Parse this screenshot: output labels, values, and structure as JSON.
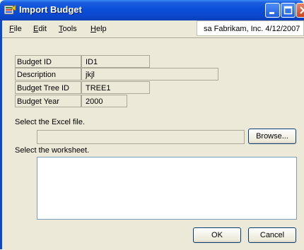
{
  "window": {
    "title": "Import Budget",
    "controls": {
      "minimize": "minimize",
      "maximize": "maximize",
      "close": "close"
    }
  },
  "menu": {
    "items": [
      {
        "label": "File",
        "accel": "F"
      },
      {
        "label": "Edit",
        "accel": "E"
      },
      {
        "label": "Tools",
        "accel": "T"
      },
      {
        "label": "Help",
        "accel": "H"
      }
    ],
    "status": "sa  Fabrikam, Inc.  4/12/2007"
  },
  "fields": {
    "budget_id": {
      "label": "Budget ID",
      "value": "ID1"
    },
    "description": {
      "label": "Description",
      "value": "jkjl"
    },
    "budget_tree_id": {
      "label": "Budget Tree ID",
      "value": "TREE1"
    },
    "budget_year": {
      "label": "Budget Year",
      "value": "2000"
    }
  },
  "excel": {
    "label": "Select  the Excel file.",
    "value": "",
    "browse_label": "Browse..."
  },
  "worksheet": {
    "label": "Select the worksheet.",
    "items": []
  },
  "buttons": {
    "ok": "OK",
    "cancel": "Cancel"
  }
}
